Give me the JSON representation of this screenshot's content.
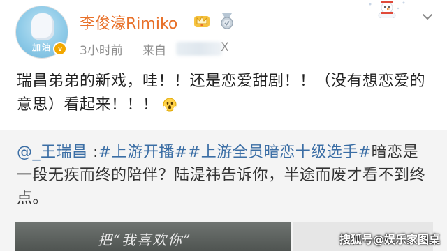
{
  "header": {
    "username": "李俊濠Rimiko",
    "time": "3小时前",
    "source_label": "来自",
    "source_suffix": "X",
    "avatar_text": "加油",
    "verified_badge": "v"
  },
  "icons": {
    "crown": "crown-icon",
    "medal": "medal-icon",
    "snowman": "snowman-icon",
    "menu": "chevron-down-icon",
    "emoji": "scream-emoji-icon"
  },
  "content": {
    "text": "瑞昌弟弟的新戏，哇！！还是恋爱甜剧！！（没有想恋爱的意思）看起来！！！"
  },
  "repost": {
    "mention": "@_王瑞昌",
    "sep": " :",
    "tag1": "#上游开播#",
    "tag2": "#上游全员暗恋十级选手#",
    "text": "暗恋是一段无疾而终的陪伴？陆湜祎告诉你，半途而废才看不到终点。",
    "image_text": "把“我喜欢你”"
  },
  "watermark": "搜狐号@娱乐家图桌",
  "colors": {
    "username": "#e8712a",
    "link": "#3b6ea5",
    "repost_bg": "#f4f4f4"
  }
}
